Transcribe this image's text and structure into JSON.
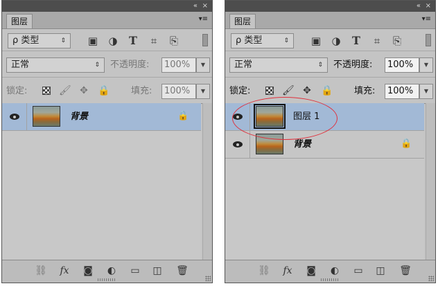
{
  "panels": {
    "left": {
      "tab_label": "图层",
      "filter": {
        "label": "ρ 类型",
        "arrows": "⇕"
      },
      "blend_mode": {
        "value": "正常",
        "arrows": "⇕"
      },
      "opacity": {
        "label": "不透明度:",
        "value": "100%"
      },
      "lock": {
        "label": "锁定:"
      },
      "fill": {
        "label": "填充:",
        "value": "100%"
      },
      "layers": [
        {
          "name": "背景",
          "locked": true,
          "selected": true
        }
      ]
    },
    "right": {
      "tab_label": "图层",
      "filter": {
        "label": "ρ 类型",
        "arrows": "⇕"
      },
      "blend_mode": {
        "value": "正常",
        "arrows": "⇕"
      },
      "opacity": {
        "label": "不透明度:",
        "value": "100%"
      },
      "lock": {
        "label": "锁定:"
      },
      "fill": {
        "label": "填充:",
        "value": "100%"
      },
      "layers": [
        {
          "name": "图层 1",
          "locked": false,
          "selected": true
        },
        {
          "name": "背景",
          "locked": true,
          "selected": false
        }
      ]
    }
  },
  "titlebar": {
    "collapse": "«",
    "close": "×",
    "menu": "▾≡"
  },
  "icons": {
    "filter_icons": [
      "image-filter-icon",
      "adjustment-filter-icon",
      "type-filter-icon",
      "shape-filter-icon",
      "smart-object-filter-icon"
    ],
    "lock_icons": [
      "lock-transparent-pixels-icon",
      "lock-image-pixels-icon",
      "lock-position-icon",
      "lock-all-icon"
    ],
    "bottom_icons": [
      "link-layers-icon",
      "fx-icon",
      "layer-mask-icon",
      "adjustment-layer-icon",
      "group-icon",
      "new-layer-icon",
      "trash-icon"
    ]
  },
  "glyphs": {
    "type": "T",
    "shape": "⌗",
    "smart": "⎘",
    "brush": "🖌",
    "move": "✥",
    "lock": "🔒",
    "link": "⛓",
    "fx": "fx",
    "mask": "◙",
    "adj": "◐",
    "group": "▭",
    "new": "◫",
    "trash": "🗑",
    "image": "▣",
    "adjust": "◑"
  },
  "colors": {
    "selected_row": "#a2b9d6",
    "highlight_circle": "#e0303c",
    "panel_bg": "#c4c4c4"
  }
}
